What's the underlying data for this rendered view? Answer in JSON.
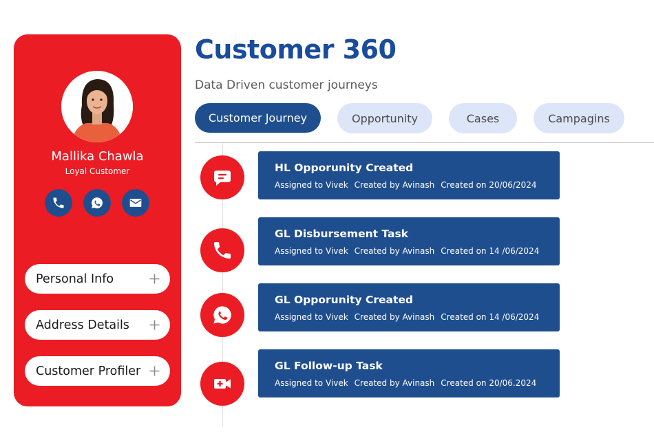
{
  "profile": {
    "name": "Mallika Chawla",
    "tag": "Loyal Customer",
    "contacts": [
      {
        "icon": "phone-icon"
      },
      {
        "icon": "whatsapp-icon"
      },
      {
        "icon": "mail-icon"
      }
    ],
    "sections": [
      {
        "label": "Personal Info"
      },
      {
        "label": "Address Details"
      },
      {
        "label": "Customer Profiler"
      }
    ]
  },
  "header": {
    "title": "Customer 360",
    "subtitle": "Data Driven customer journeys"
  },
  "tabs": [
    {
      "label": "Customer Journey",
      "active": true
    },
    {
      "label": "Opportunity",
      "active": false
    },
    {
      "label": "Cases",
      "active": false
    },
    {
      "label": "Campagins",
      "active": false
    }
  ],
  "timeline": [
    {
      "icon": "chat-icon",
      "title": "HL Opporunity Created",
      "assigned": "Assigned to Vivek",
      "created_by": "Created by Avinash",
      "created_on": "Created on 20/06/2024"
    },
    {
      "icon": "phone-icon",
      "title": "GL Disbursement Task",
      "assigned": "Assigned to Vivek",
      "created_by": "Created by Avinash",
      "created_on": "Created on 14 /06/2024"
    },
    {
      "icon": "whatsapp-icon",
      "title": "GL Opporunity Created",
      "assigned": "Assigned to Vivek",
      "created_by": "Created by Avinash",
      "created_on": "Created on 14 /06/2024"
    },
    {
      "icon": "video-call-icon",
      "title": "GL Follow-up Task",
      "assigned": "Assigned to Vivek",
      "created_by": "Created by Avinash",
      "created_on": "Created on 20/06.2024"
    }
  ],
  "colors": {
    "brand_red": "#ec1c24",
    "brand_blue": "#1f4e8f",
    "title_blue": "#1a4c9c",
    "tab_inactive": "#dde6f9"
  }
}
